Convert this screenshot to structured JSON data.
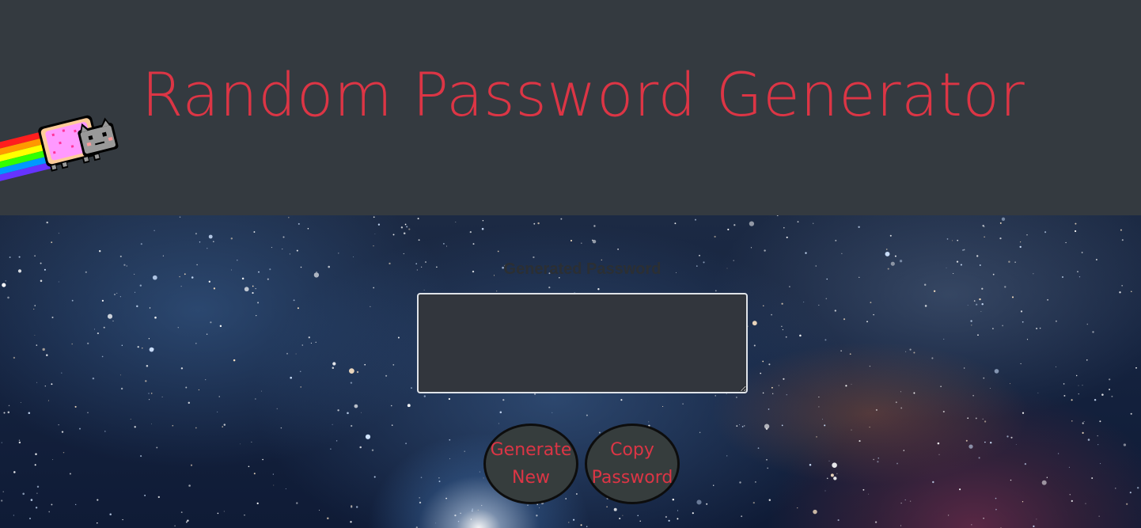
{
  "header": {
    "title": "Random Password Generator"
  },
  "icons": {
    "mascot": "nyan-cat-icon"
  },
  "card": {
    "label": "Generated Password",
    "password_value": "",
    "password_placeholder": ""
  },
  "buttons": {
    "generate_label": "Generate New",
    "copy_label": "Copy Password"
  },
  "colors": {
    "header_bg": "#343a40",
    "accent": "#dc3545",
    "button_bg": "#363d3d",
    "textarea_bg": "#32363d"
  }
}
